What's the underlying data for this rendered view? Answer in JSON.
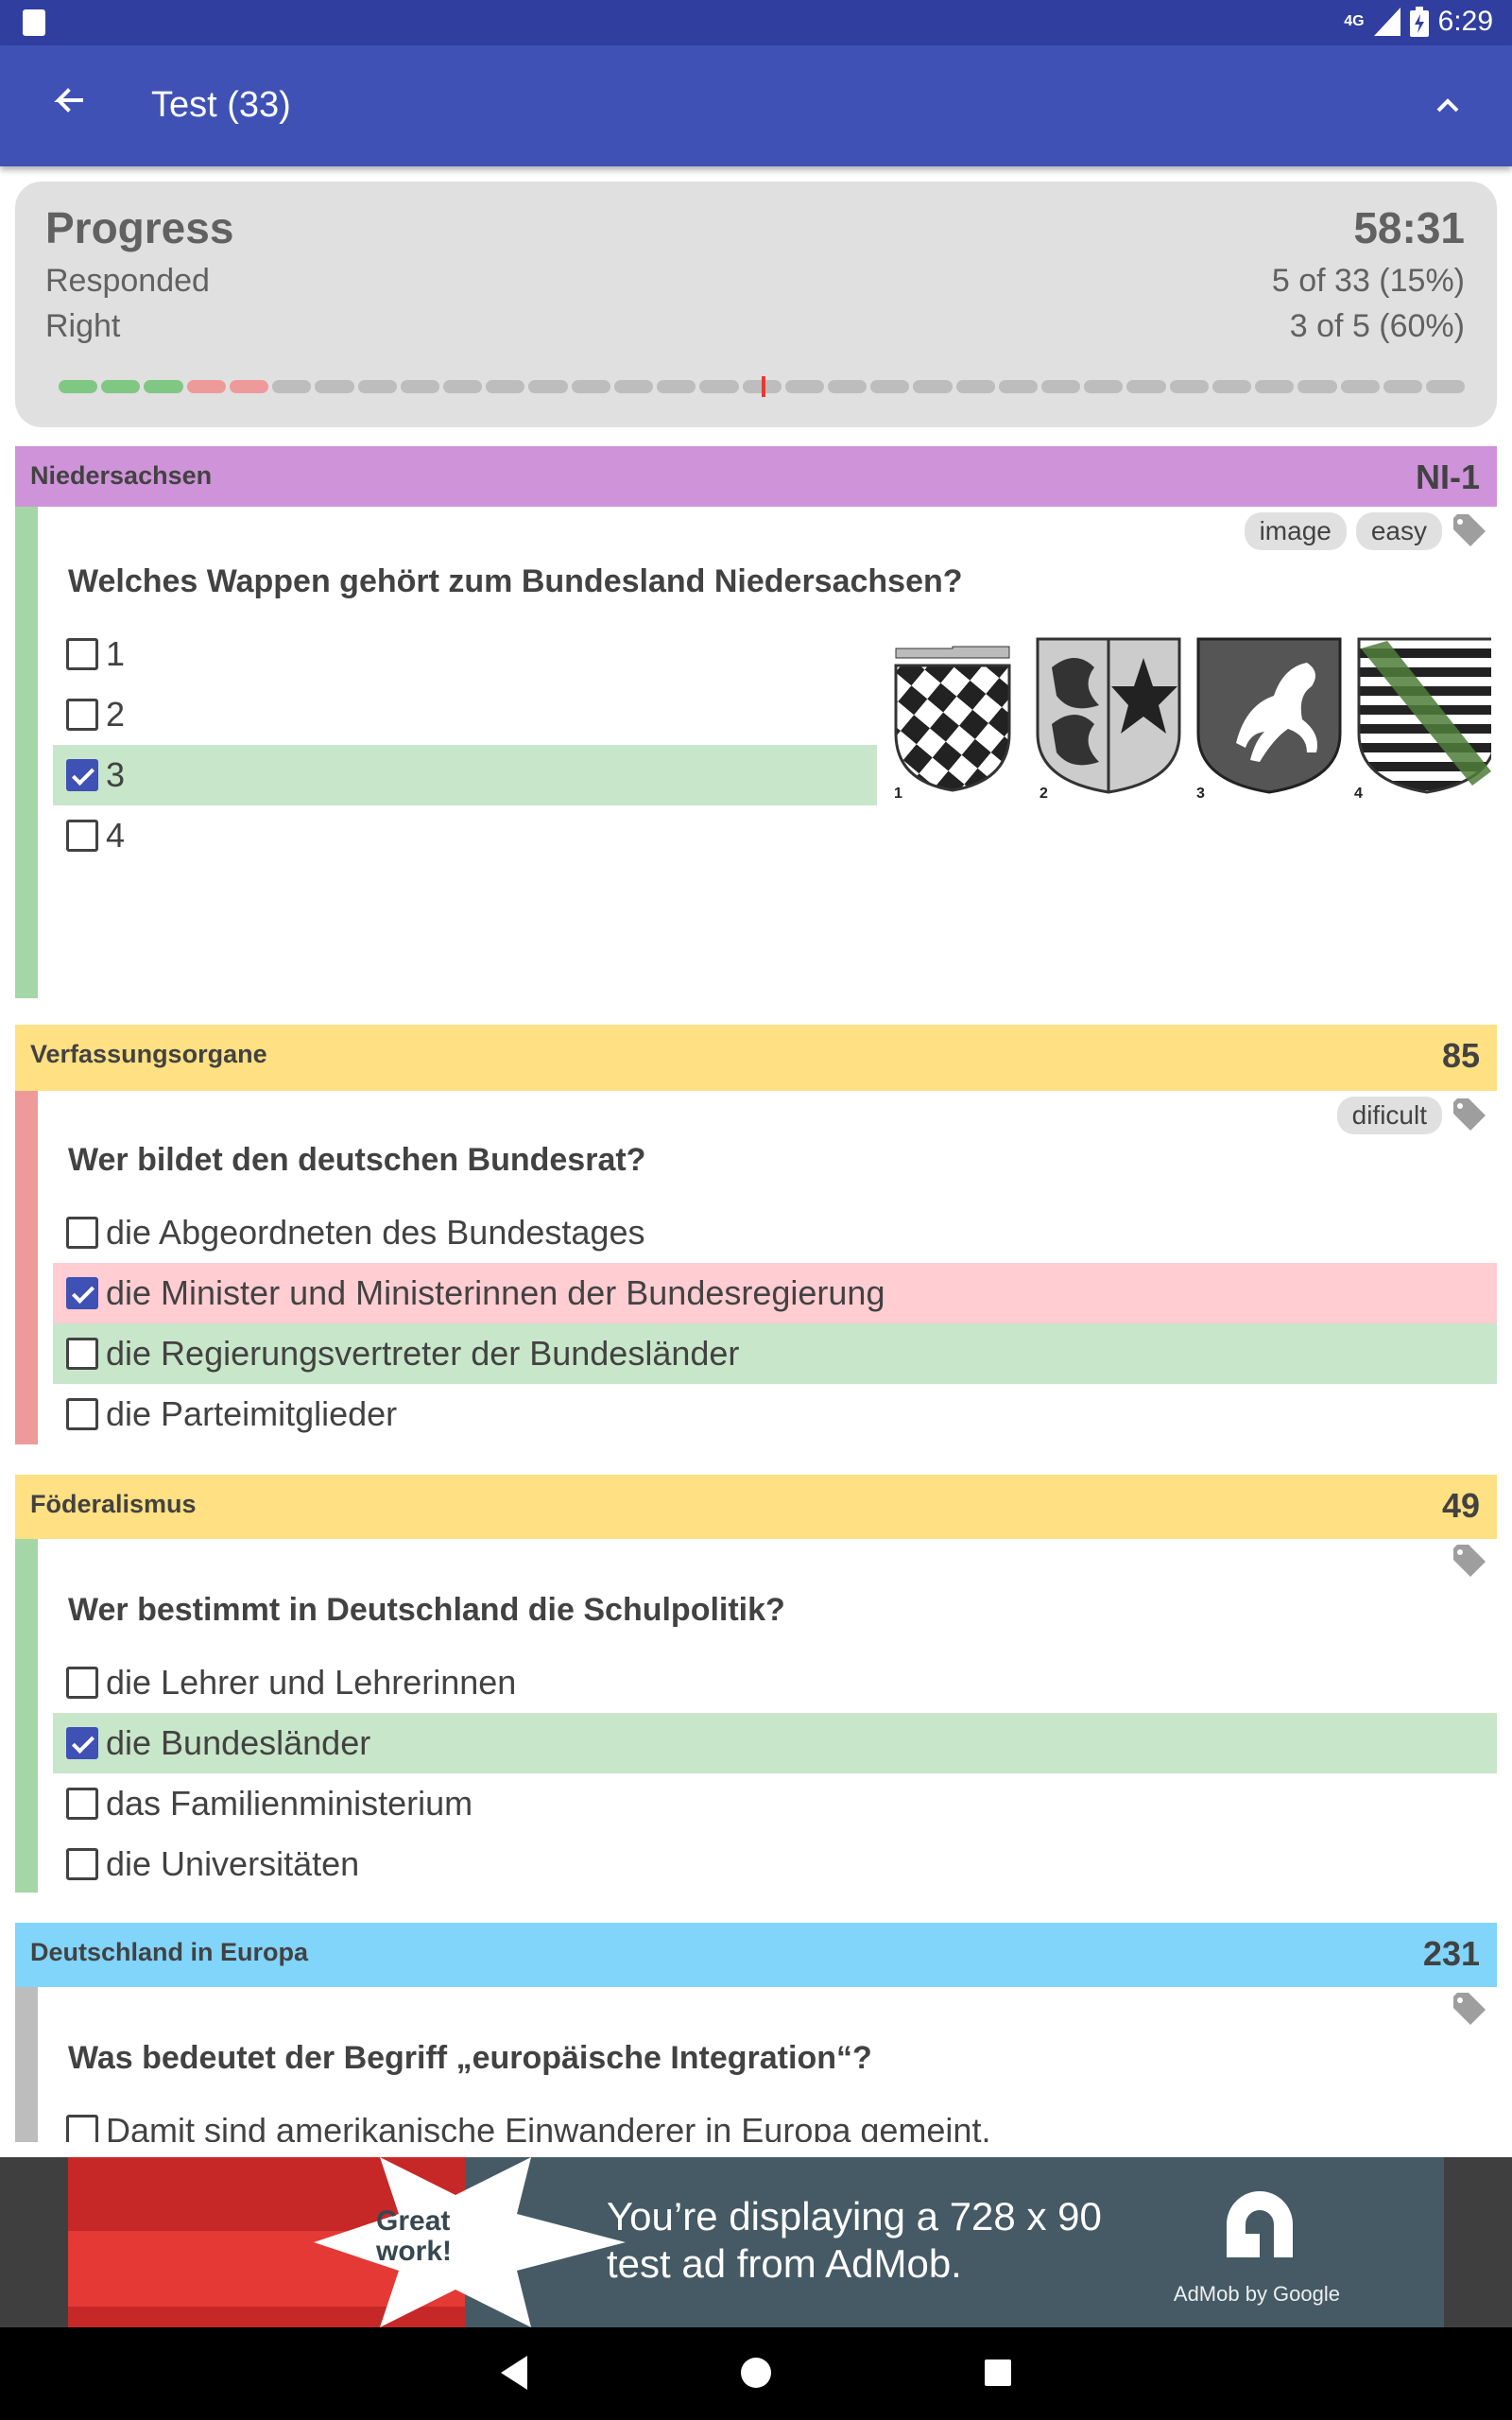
{
  "status_bar": {
    "network": "4G",
    "time": "6:29",
    "icons": [
      "sd-card-icon",
      "signal-icon",
      "battery-icon"
    ]
  },
  "app_bar": {
    "title": "Test (33)",
    "back_icon": "arrow-back-icon",
    "collapse_icon": "chevron-up-icon"
  },
  "progress": {
    "title": "Progress",
    "time": "58:31",
    "responded_label": "Responded",
    "responded_value": "5 of 33 (15%)",
    "right_label": "Right",
    "right_value": "3 of 5 (60%)",
    "segments": [
      "ok",
      "ok",
      "ok",
      "bad",
      "bad",
      "none",
      "none",
      "none",
      "none",
      "none",
      "none",
      "none",
      "none",
      "none",
      "none",
      "none",
      "cur",
      "none",
      "none",
      "none",
      "none",
      "none",
      "none",
      "none",
      "none",
      "none",
      "none",
      "none",
      "none",
      "none",
      "none",
      "none",
      "none"
    ]
  },
  "questions": [
    {
      "category": "Niedersachsen",
      "number": "NI-1",
      "color": "#ce93d8",
      "strip_color": "#a5d6a7",
      "tags": [
        "image",
        "easy"
      ],
      "question": "Welches Wappen gehört zum Bundesland Niedersachsen?",
      "options": [
        {
          "label": "1",
          "checked": false,
          "highlight": "none"
        },
        {
          "label": "2",
          "checked": false,
          "highlight": "none"
        },
        {
          "label": "3",
          "checked": true,
          "highlight": "green"
        },
        {
          "label": "4",
          "checked": false,
          "highlight": "none"
        }
      ],
      "image_labels": [
        "1",
        "2",
        "3",
        "4"
      ]
    },
    {
      "category": "Verfassungsorgane",
      "number": "85",
      "color": "#ffe082",
      "strip_color": "#ef9a9a",
      "tags": [
        "dificult"
      ],
      "question": "Wer bildet den deutschen Bundesrat?",
      "options": [
        {
          "label": "die Abgeordneten des Bundestages",
          "checked": false,
          "highlight": "none"
        },
        {
          "label": "die Minister und Ministerinnen der Bundesregierung",
          "checked": true,
          "highlight": "red"
        },
        {
          "label": "die Regierungsvertreter der Bundesländer",
          "checked": false,
          "highlight": "green"
        },
        {
          "label": "die Parteimitglieder",
          "checked": false,
          "highlight": "none"
        }
      ]
    },
    {
      "category": "Föderalismus",
      "number": "49",
      "color": "#ffe082",
      "strip_color": "#a5d6a7",
      "tags": [],
      "question": "Wer bestimmt in Deutschland die Schulpolitik?",
      "options": [
        {
          "label": "die Lehrer und Lehrerinnen",
          "checked": false,
          "highlight": "none"
        },
        {
          "label": "die Bundesländer",
          "checked": true,
          "highlight": "green"
        },
        {
          "label": "das Familienministerium",
          "checked": false,
          "highlight": "none"
        },
        {
          "label": "die Universitäten",
          "checked": false,
          "highlight": "none"
        }
      ]
    },
    {
      "category": "Deutschland in Europa",
      "number": "231",
      "color": "#81d4fa",
      "strip_color": "#bdbdbd",
      "tags": [],
      "question": "Was bedeutet der Begriff „europäische Integration“?",
      "options": [
        {
          "label": "Damit sind amerikanische Einwanderer in Europa gemeint.",
          "checked": false,
          "highlight": "none"
        }
      ]
    }
  ],
  "ad": {
    "badge_line1": "Great",
    "badge_line2": "work!",
    "text_line1": "You’re displaying a 728 x 90",
    "text_line2": "test ad from AdMob.",
    "brand": "AdMob by Google"
  },
  "nav_bar": {
    "icons": [
      "back-triangle-icon",
      "home-circle-icon",
      "recents-square-icon"
    ]
  }
}
